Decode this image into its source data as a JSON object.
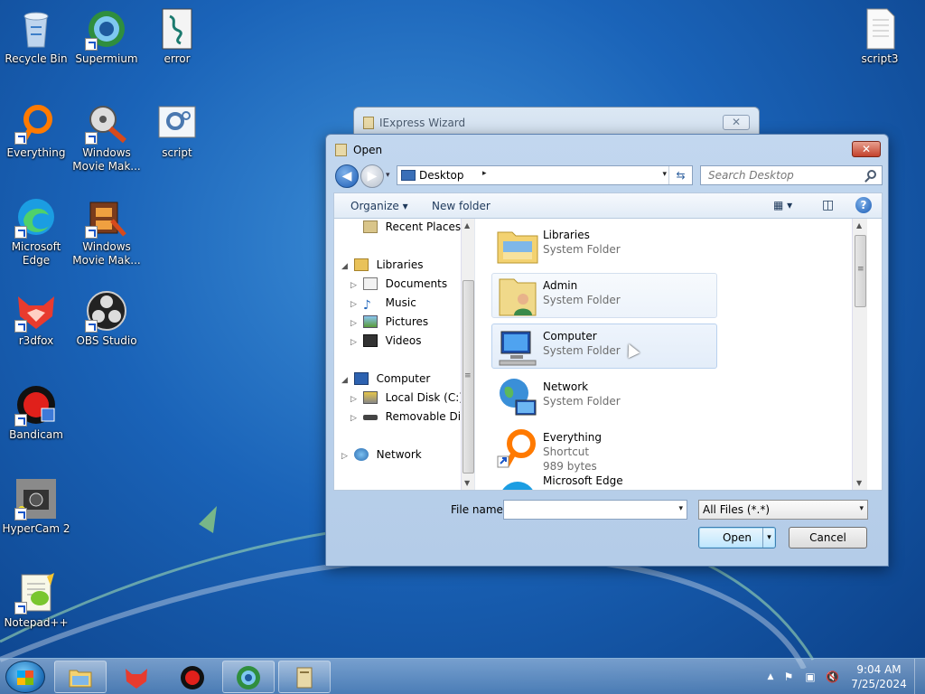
{
  "desktop": {
    "icons": [
      {
        "label": "Recycle Bin"
      },
      {
        "label": "Supermium"
      },
      {
        "label": "error"
      },
      {
        "label": "Everything"
      },
      {
        "label": "Windows Movie Mak..."
      },
      {
        "label": "script"
      },
      {
        "label": "Microsoft Edge"
      },
      {
        "label": "Windows Movie Mak..."
      },
      {
        "label": "r3dfox"
      },
      {
        "label": "OBS Studio"
      },
      {
        "label": "Bandicam"
      },
      {
        "label": "HyperCam 2"
      },
      {
        "label": "Notepad++"
      },
      {
        "label": "script3"
      }
    ]
  },
  "background_window": {
    "title": "IExpress Wizard",
    "close_glyph": "✕"
  },
  "dialog": {
    "title": "Open",
    "close_glyph": "✕",
    "address": {
      "location": "Desktop",
      "arrow": "▸",
      "dropdown": "▾",
      "refresh_glyph": "⇆"
    },
    "search": {
      "placeholder": "Search Desktop"
    },
    "toolbar": {
      "organize": "Organize ▾",
      "new_folder": "New folder",
      "view_glyph": "▦ ▾",
      "pane_glyph": "◫",
      "help": "?"
    },
    "nav_pane": {
      "items": [
        {
          "label": "Recent Places",
          "expander": ""
        },
        {
          "label": "Libraries",
          "expander": "◢"
        },
        {
          "label": "Documents",
          "expander": "▷"
        },
        {
          "label": "Music",
          "expander": "▷"
        },
        {
          "label": "Pictures",
          "expander": "▷"
        },
        {
          "label": "Videos",
          "expander": "▷"
        },
        {
          "label": "Computer",
          "expander": "◢"
        },
        {
          "label": "Local Disk (C:)",
          "expander": "▷"
        },
        {
          "label": "Removable Disk (",
          "expander": "▷"
        },
        {
          "label": "Network",
          "expander": "▷"
        }
      ],
      "scroll_up": "▲",
      "scroll_down": "▼",
      "scroll_grip": "≡"
    },
    "files": [
      {
        "name": "Libraries",
        "type": "System Folder",
        "size": ""
      },
      {
        "name": "Admin",
        "type": "System Folder",
        "size": ""
      },
      {
        "name": "Computer",
        "type": "System Folder",
        "size": ""
      },
      {
        "name": "Network",
        "type": "System Folder",
        "size": ""
      },
      {
        "name": "Everything",
        "type": "Shortcut",
        "size": "989 bytes"
      },
      {
        "name": "Microsoft Edge",
        "type": "",
        "size": ""
      }
    ],
    "file_scroll": {
      "up": "▲",
      "down": "▼",
      "grip": "≡"
    },
    "file_name_label": "File name:",
    "file_name_value": "",
    "file_name_dropdown": "▾",
    "file_type_value": "All Files (*.*)",
    "file_type_dropdown": "▾",
    "open_button": "Open",
    "open_split": "▾",
    "cancel_button": "Cancel"
  },
  "taskbar": {
    "clock_time": "9:04 AM",
    "clock_date": "7/25/2024",
    "tray_icons": [
      "▲",
      "⚑",
      "▣",
      "🔇"
    ]
  },
  "colors": {
    "desktop_blue": "#1a63b8",
    "dialog_frame": "#c2d7ef",
    "close_red": "#c3422c",
    "selection": "#e3edf9"
  }
}
